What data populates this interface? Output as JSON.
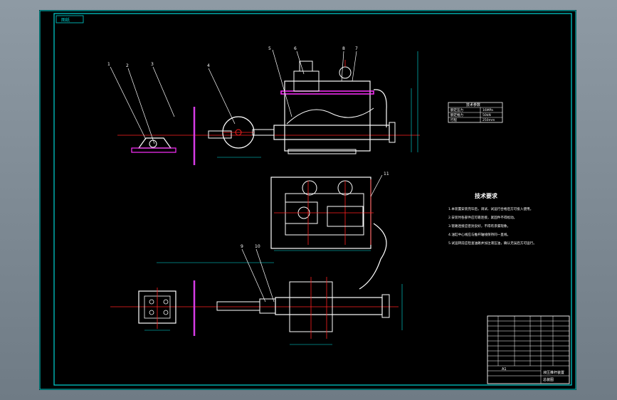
{
  "title_tag": "图纸",
  "balloons": [
    "1",
    "2",
    "3",
    "4",
    "5",
    "6",
    "7",
    "8",
    "9",
    "10",
    "11"
  ],
  "tech_req": {
    "title": "技术要求",
    "items": [
      "1.本装置安装完毕后，调试、试运行合格后方可投入使用。",
      "2.安装时各部件应可靠连接，紧固件不得松动。",
      "3.管路连接应密封良好，不得有渗漏现象。",
      "4.油缸中心线应与推杆轴线保持同一直线。",
      "5.试运转前应检查油路并加注液压油，确认无误后方可运行。"
    ]
  },
  "param_table": {
    "title": "技术参数",
    "rows": [
      [
        "额定压力",
        "16MPa"
      ],
      [
        "额定推力",
        "50kN"
      ],
      [
        "行程",
        "250mm"
      ]
    ]
  },
  "title_block": {
    "name": "液压推杆装置",
    "drawing_no": "总装图",
    "sheet": "A1"
  },
  "colors": {
    "frame": "#00d4d4",
    "outline": "#ffffff",
    "center": "#ff2020",
    "accent": "#ff30ff",
    "dim": "#00e5e5",
    "mag": "#d63ce6"
  }
}
